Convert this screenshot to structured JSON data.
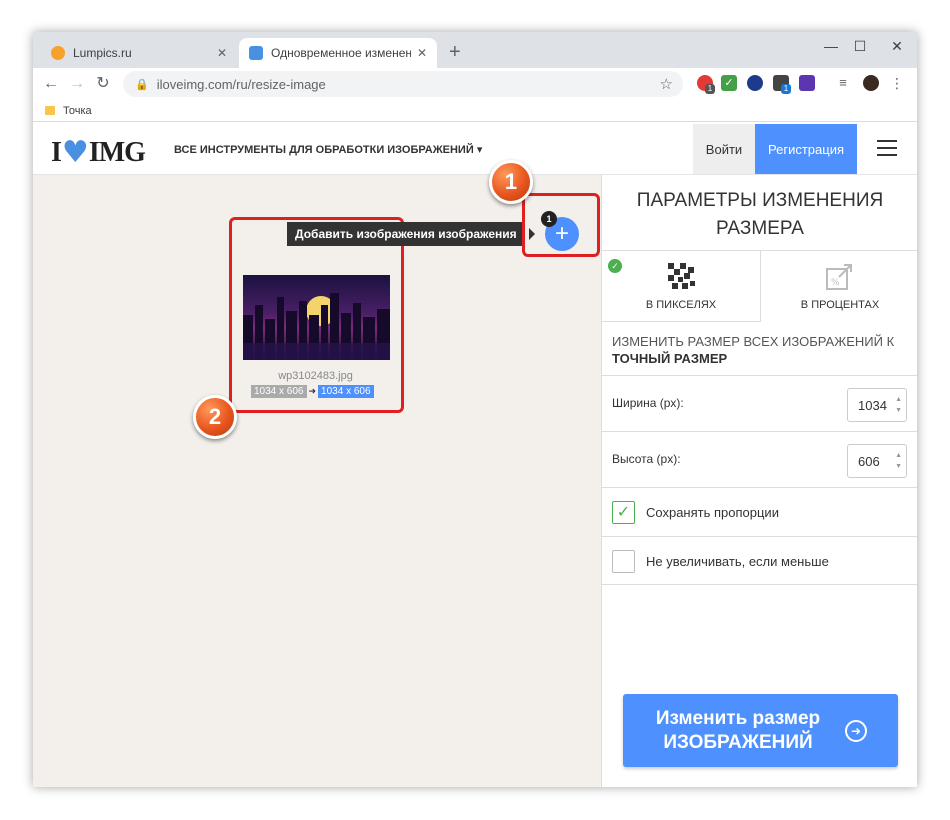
{
  "browser": {
    "tabs": [
      {
        "label": "Lumpics.ru",
        "favicon_color": "#f7a12c"
      },
      {
        "label": "Одновременное изменение ра",
        "favicon_color": "#4a90e2"
      }
    ],
    "url": "iloveimg.com/ru/resize-image",
    "bookmark": "Точка",
    "ext_badge_1": "1",
    "ext_badge_2": "1"
  },
  "site": {
    "logo_left": "I",
    "logo_right": "IMG",
    "tools_menu": "ВСЕ ИНСТРУМЕНТЫ ДЛЯ ОБРАБОТКИ ИЗОБРАЖЕНИЙ",
    "login": "Войти",
    "register": "Регистрация"
  },
  "workspace": {
    "tooltip": "Добавить изображения изображения",
    "add_badge": "1",
    "file": {
      "name": "wp3102483.jpg",
      "from_size": "1034 x 606",
      "to_size": "1034 x 606"
    },
    "markers": [
      "1",
      "2"
    ]
  },
  "panel": {
    "title": "ПАРАМЕТРЫ ИЗМЕНЕНИЯ РАЗМЕРА",
    "tab_pixels": "В ПИКСЕЛЯХ",
    "tab_percent": "В ПРОЦЕНТАХ",
    "desc_line": "ИЗМЕНИТЬ РАЗМЕР ВСЕХ ИЗОБРАЖЕНИЙ К",
    "desc_bold": "ТОЧНЫЙ РАЗМЕР",
    "width_label": "Ширина (px):",
    "width_value": "1034",
    "height_label": "Высота (px):",
    "height_value": "606",
    "keep_ratio": "Сохранять пропорции",
    "keep_ratio_checked": true,
    "no_enlarge": "Не увеличивать, если меньше",
    "no_enlarge_checked": false,
    "button_line1": "Изменить размер",
    "button_line2": "ИЗОБРАЖЕНИЙ"
  },
  "colors": {
    "accent": "#4d90fe",
    "marker": "#e8561e",
    "highlight": "#e02020",
    "check": "#4caf50"
  }
}
